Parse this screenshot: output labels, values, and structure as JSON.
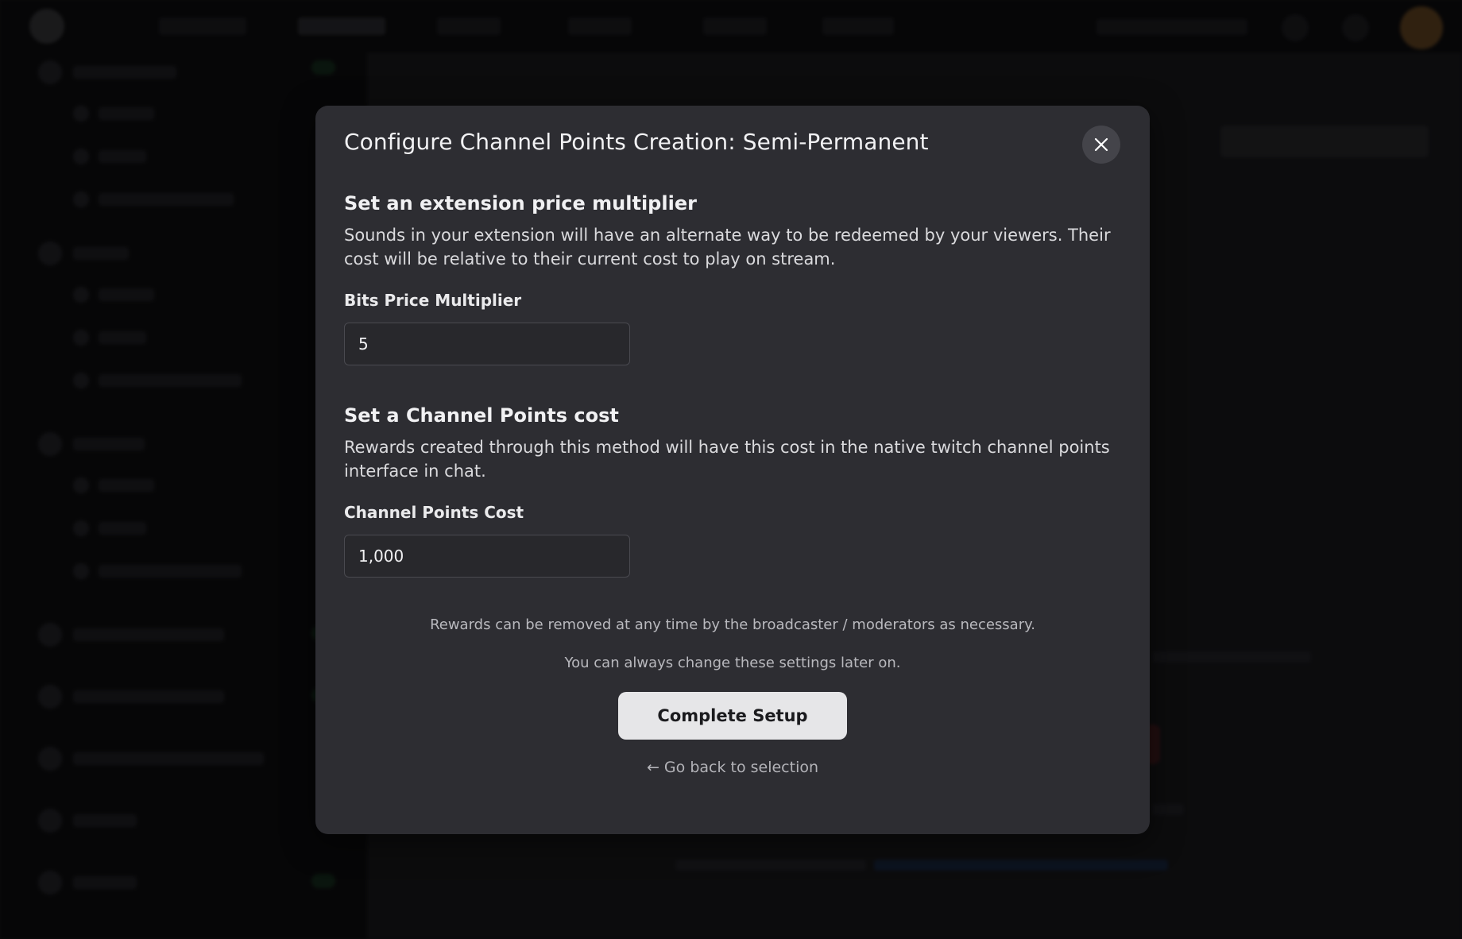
{
  "modal": {
    "title": "Configure Channel Points Creation: Semi-Permanent",
    "close_icon": "close-icon",
    "section_multiplier": {
      "heading": "Set an extension price multiplier",
      "description": "Sounds in your extension will have an alternate way to be redeemed by your viewers. Their cost will be relative to their current cost to play on stream.",
      "field_label": "Bits Price Multiplier",
      "field_value": "5"
    },
    "section_cost": {
      "heading": "Set a Channel Points cost",
      "description": "Rewards created through this method will have this cost in the native twitch channel points interface in chat.",
      "field_label": "Channel Points Cost",
      "field_value": "1,000"
    },
    "note_removal": "Rewards can be removed at any time by the broadcaster / moderators as necessary.",
    "note_change": "You can always change these settings later on.",
    "complete_button": "Complete Setup",
    "back_link": "← Go back to selection"
  },
  "colors": {
    "modal_bg": "#2d2d32",
    "overlay": "#000000",
    "button_bg": "#e6e6e8",
    "button_text": "#1b1b1e"
  }
}
